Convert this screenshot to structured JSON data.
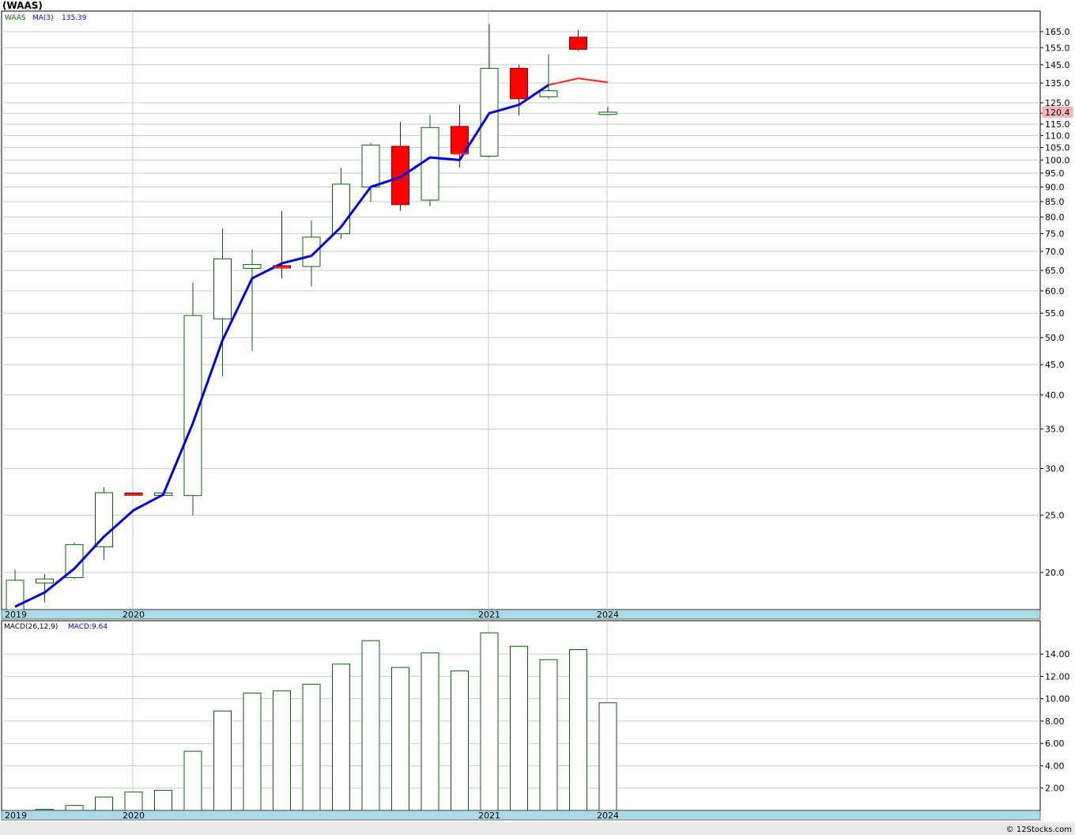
{
  "header": {
    "title": "(WAAS)"
  },
  "price_panel": {
    "legend": {
      "symbol": "WAAS",
      "ma_label": "MA(3)",
      "ma_value": "135.39"
    },
    "last_price": "120.4",
    "y_ticks": [
      "165.0",
      "155.0",
      "145.0",
      "135.0",
      "125.0",
      "120.0",
      "115.0",
      "110.0",
      "105.0",
      "100.0",
      "95.0",
      "90.0",
      "85.0",
      "80.0",
      "75.0",
      "70.0",
      "65.0",
      "60.0",
      "55.0",
      "50.0",
      "45.0",
      "40.0",
      "35.0",
      "30.0",
      "25.0",
      "20.0"
    ],
    "x_ticks": [
      "2019",
      "2020",
      "2021",
      "2024"
    ]
  },
  "macd_panel": {
    "legend": {
      "label": "MACD(26,12,9)",
      "value_label": "MACD:9.64"
    },
    "y_ticks": [
      "14.00",
      "12.00",
      "10.00",
      "8.00",
      "6.00",
      "4.00",
      "2.00"
    ],
    "x_ticks": [
      "2019",
      "2020",
      "2021",
      "2024"
    ]
  },
  "footer": {
    "credit": "© 12Stocks.com"
  },
  "colors": {
    "up": "#006400",
    "down": "#ff0000",
    "ma_up": "#0000dd",
    "ma_down": "#ff2020",
    "grid": "#c8c8c8",
    "axis_band": "#add8e6",
    "last_price_bg": "#ffb6b6"
  },
  "chart_data": [
    {
      "type": "candlestick",
      "title": "(WAAS)",
      "scale": "log",
      "ylim": [
        17,
        175
      ],
      "candles": [
        {
          "o": 17.2,
          "h": 20.2,
          "l": 16.9,
          "c": 19.4
        },
        {
          "o": 19.2,
          "h": 19.9,
          "l": 17.8,
          "c": 19.5
        },
        {
          "o": 19.6,
          "h": 22.5,
          "l": 19.5,
          "c": 22.3
        },
        {
          "o": 22.1,
          "h": 27.9,
          "l": 21.0,
          "c": 27.3
        },
        {
          "o": 27.2,
          "h": 27.2,
          "l": 27.1,
          "c": 27.1
        },
        {
          "o": 27.1,
          "h": 27.2,
          "l": 27.0,
          "c": 27.2
        },
        {
          "o": 27.0,
          "h": 62.0,
          "l": 25.0,
          "c": 54.5
        },
        {
          "o": 53.8,
          "h": 76.5,
          "l": 43.0,
          "c": 68.0
        },
        {
          "o": 65.5,
          "h": 70.5,
          "l": 47.5,
          "c": 66.5
        },
        {
          "o": 66.0,
          "h": 82.0,
          "l": 63.0,
          "c": 65.8
        },
        {
          "o": 66.0,
          "h": 79.0,
          "l": 61.0,
          "c": 74.0
        },
        {
          "o": 75.0,
          "h": 97.0,
          "l": 73.5,
          "c": 91.0
        },
        {
          "o": 90.0,
          "h": 107.0,
          "l": 85.0,
          "c": 106.0
        },
        {
          "o": 105.5,
          "h": 116.0,
          "l": 82.0,
          "c": 84.0
        },
        {
          "o": 85.5,
          "h": 119.0,
          "l": 83.5,
          "c": 113.5
        },
        {
          "o": 114.0,
          "h": 124.0,
          "l": 97.0,
          "c": 102.5
        },
        {
          "o": 101.5,
          "h": 170.0,
          "l": 101.0,
          "c": 143.0
        },
        {
          "o": 143.0,
          "h": 145.0,
          "l": 119.0,
          "c": 127.0
        },
        {
          "o": 128.0,
          "h": 151.0,
          "l": 127.0,
          "c": 131.0
        },
        {
          "o": 161.5,
          "h": 166.0,
          "l": 153.0,
          "c": 154.0
        },
        {
          "o": 119.5,
          "h": 123.0,
          "l": 119.0,
          "c": 120.4
        }
      ],
      "ma3": [
        17.5,
        18.5,
        20.3,
        23.0,
        25.5,
        27.1,
        35.8,
        49.5,
        63.0,
        66.8,
        68.8,
        77.0,
        90.0,
        93.5,
        101.0,
        100.0,
        120.0,
        124.0,
        134.0,
        137.5,
        135.39
      ],
      "ma3_down_from_index": 19
    },
    {
      "type": "bar",
      "title": "MACD(26,12,9)",
      "ylim": [
        0,
        16
      ],
      "values": [
        0.0,
        0.1,
        0.45,
        1.2,
        1.65,
        1.8,
        5.3,
        8.9,
        10.5,
        10.7,
        11.3,
        13.1,
        15.2,
        12.8,
        14.1,
        12.5,
        15.9,
        14.7,
        13.5,
        14.4,
        9.64
      ]
    }
  ]
}
